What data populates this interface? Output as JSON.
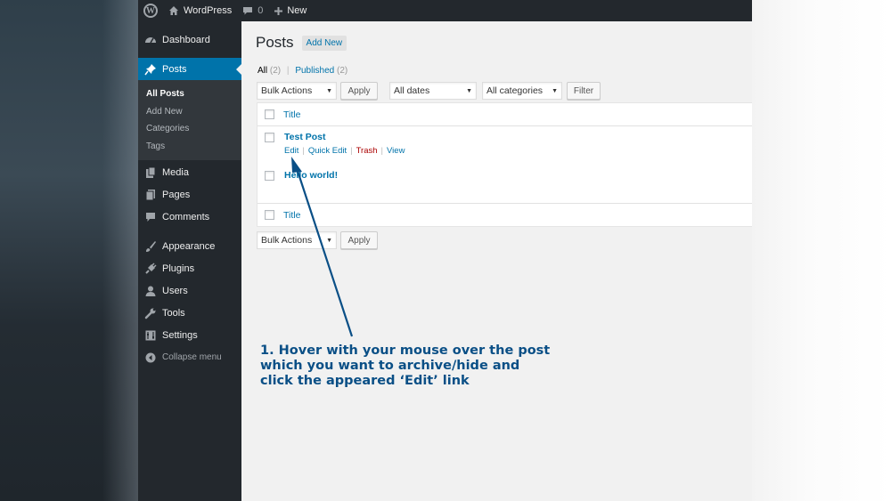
{
  "admin_bar": {
    "site_name": "WordPress",
    "comments_count": "0",
    "new_label": "New"
  },
  "sidebar": {
    "items": [
      {
        "label": "Dashboard",
        "icon": "dashboard-icon"
      },
      {
        "label": "Posts",
        "icon": "pin-icon"
      },
      {
        "label": "Media",
        "icon": "media-icon"
      },
      {
        "label": "Pages",
        "icon": "pages-icon"
      },
      {
        "label": "Comments",
        "icon": "comment-icon"
      },
      {
        "label": "Appearance",
        "icon": "brush-icon"
      },
      {
        "label": "Plugins",
        "icon": "plug-icon"
      },
      {
        "label": "Users",
        "icon": "user-icon"
      },
      {
        "label": "Tools",
        "icon": "wrench-icon"
      },
      {
        "label": "Settings",
        "icon": "settings-icon"
      }
    ],
    "submenu": [
      "All Posts",
      "Add New",
      "Categories",
      "Tags"
    ],
    "collapse_label": "Collapse menu"
  },
  "page": {
    "title": "Posts",
    "add_new": "Add New",
    "filters": {
      "all_label": "All",
      "all_count": "(2)",
      "published_label": "Published",
      "published_count": "(2)",
      "separator": "|"
    },
    "bulk_actions": "Bulk Actions",
    "apply": "Apply",
    "dates": "All dates",
    "categories": "All categories",
    "filter": "Filter",
    "column_title": "Title",
    "posts": [
      {
        "title": "Test Post"
      },
      {
        "title": "Hello world!"
      }
    ],
    "row_actions": {
      "edit": "Edit",
      "quick_edit": "Quick Edit",
      "trash": "Trash",
      "view": "View"
    }
  },
  "annotation": {
    "line1": "1. Hover with your mouse over the post",
    "line2": "which you want to archive/hide and",
    "line3": "click the appeared ‘Edit’ link"
  },
  "colors": {
    "admin_bg": "#23282d",
    "accent": "#0073aa",
    "trash": "#aa0000",
    "annotation": "#0a4f86"
  }
}
